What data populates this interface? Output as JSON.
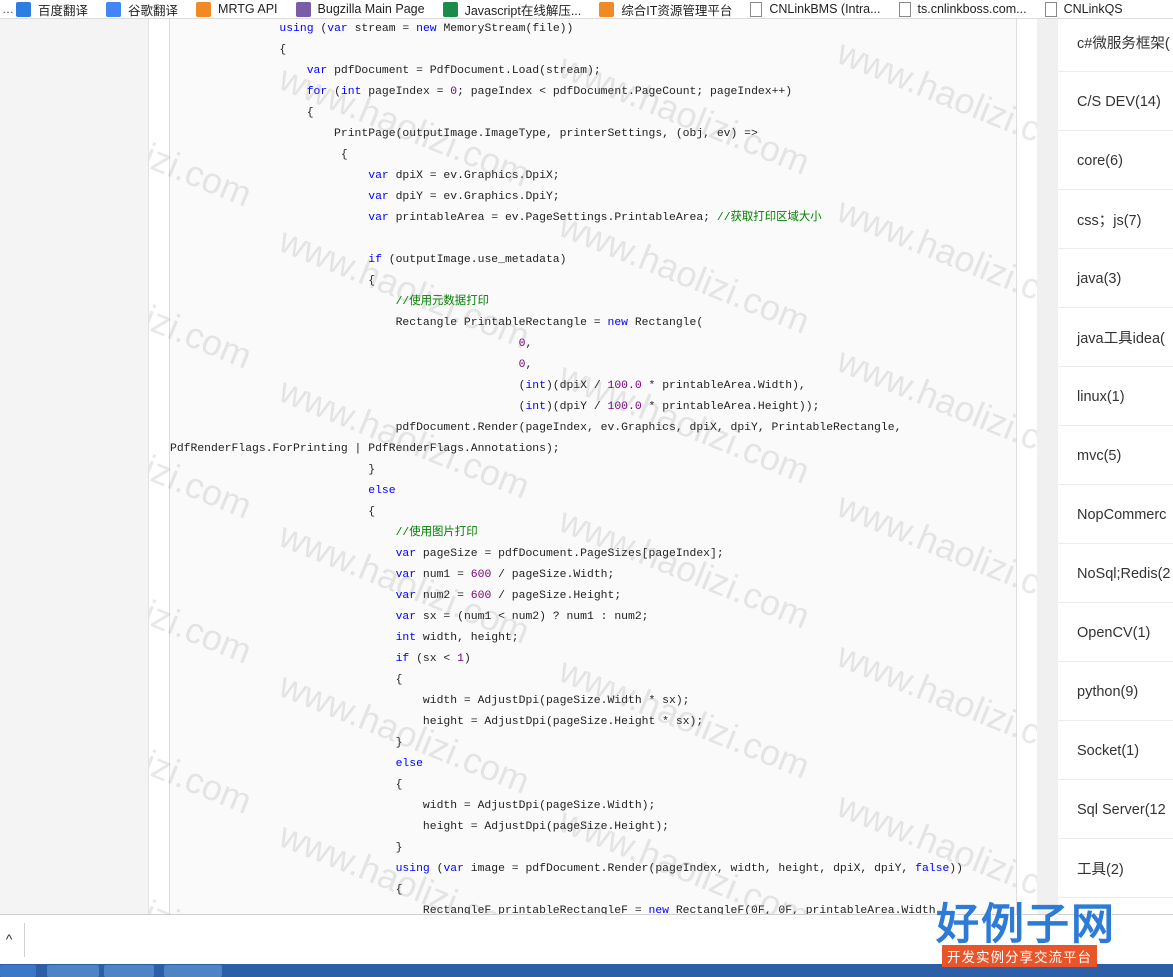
{
  "bookmarks": [
    {
      "label": "百度翻译",
      "icon": "baidu-translate-icon",
      "color": "#2e7de1"
    },
    {
      "label": "谷歌翻译",
      "icon": "google-translate-icon",
      "color": "#4285f4"
    },
    {
      "label": "MRTG API",
      "icon": "mrtg-icon",
      "color": "#f08a24"
    },
    {
      "label": "Bugzilla Main Page",
      "icon": "bugzilla-icon",
      "color": "#7a5ca8"
    },
    {
      "label": "Javascript在线解压...",
      "icon": "javascript-tool-icon",
      "color": "#1d8a4a"
    },
    {
      "label": "综合IT资源管理平台",
      "icon": "it-platform-icon",
      "color": "#f08a24"
    },
    {
      "label": "CNLinkBMS (Intra...",
      "icon": "page-icon",
      "color": "#ffffff"
    },
    {
      "label": "ts.cnlinkboss.com...",
      "icon": "page-icon",
      "color": "#ffffff"
    },
    {
      "label": "CNLinkQS",
      "icon": "page-icon",
      "color": "#ffffff"
    }
  ],
  "code_lines": [
    [
      {
        "t": "pl",
        "v": "                "
      },
      {
        "t": "kw",
        "v": "using"
      },
      {
        "t": "pl",
        "v": " ("
      },
      {
        "t": "kw",
        "v": "var"
      },
      {
        "t": "pl",
        "v": " stream = "
      },
      {
        "t": "kw",
        "v": "new"
      },
      {
        "t": "pl",
        "v": " MemoryStream(file))"
      }
    ],
    [
      {
        "t": "pl",
        "v": "                {"
      }
    ],
    [
      {
        "t": "pl",
        "v": "                    "
      },
      {
        "t": "kw",
        "v": "var"
      },
      {
        "t": "pl",
        "v": " pdfDocument = PdfDocument.Load(stream);"
      }
    ],
    [
      {
        "t": "pl",
        "v": "                    "
      },
      {
        "t": "kw",
        "v": "for"
      },
      {
        "t": "pl",
        "v": " ("
      },
      {
        "t": "kw",
        "v": "int"
      },
      {
        "t": "pl",
        "v": " pageIndex = "
      },
      {
        "t": "num",
        "v": "0"
      },
      {
        "t": "pl",
        "v": "; pageIndex < pdfDocument.PageCount; pageIndex++)"
      }
    ],
    [
      {
        "t": "pl",
        "v": "                    {"
      }
    ],
    [
      {
        "t": "pl",
        "v": "                        PrintPage(outputImage.ImageType, printerSettings, (obj, ev) =>"
      }
    ],
    [
      {
        "t": "pl",
        "v": "                         {"
      }
    ],
    [
      {
        "t": "pl",
        "v": "                             "
      },
      {
        "t": "kw",
        "v": "var"
      },
      {
        "t": "pl",
        "v": " dpiX = ev.Graphics.DpiX;"
      }
    ],
    [
      {
        "t": "pl",
        "v": "                             "
      },
      {
        "t": "kw",
        "v": "var"
      },
      {
        "t": "pl",
        "v": " dpiY = ev.Graphics.DpiY;"
      }
    ],
    [
      {
        "t": "pl",
        "v": "                             "
      },
      {
        "t": "kw",
        "v": "var"
      },
      {
        "t": "pl",
        "v": " printableArea = ev.PageSettings.PrintableArea; "
      },
      {
        "t": "cm",
        "v": "//获取打印区域大小"
      }
    ],
    [
      {
        "t": "pl",
        "v": ""
      }
    ],
    [
      {
        "t": "pl",
        "v": "                             "
      },
      {
        "t": "kw",
        "v": "if"
      },
      {
        "t": "pl",
        "v": " (outputImage.use_metadata)"
      }
    ],
    [
      {
        "t": "pl",
        "v": "                             {"
      }
    ],
    [
      {
        "t": "pl",
        "v": "                                 "
      },
      {
        "t": "cm",
        "v": "//使用元数据打印"
      }
    ],
    [
      {
        "t": "pl",
        "v": "                                 Rectangle PrintableRectangle = "
      },
      {
        "t": "kw",
        "v": "new"
      },
      {
        "t": "pl",
        "v": " Rectangle("
      }
    ],
    [
      {
        "t": "pl",
        "v": "                                                   "
      },
      {
        "t": "num",
        "v": "0"
      },
      {
        "t": "pl",
        "v": ","
      }
    ],
    [
      {
        "t": "pl",
        "v": "                                                   "
      },
      {
        "t": "num",
        "v": "0"
      },
      {
        "t": "pl",
        "v": ","
      }
    ],
    [
      {
        "t": "pl",
        "v": "                                                   ("
      },
      {
        "t": "kw",
        "v": "int"
      },
      {
        "t": "pl",
        "v": ")(dpiX / "
      },
      {
        "t": "num",
        "v": "100.0"
      },
      {
        "t": "pl",
        "v": " * printableArea.Width),"
      }
    ],
    [
      {
        "t": "pl",
        "v": "                                                   ("
      },
      {
        "t": "kw",
        "v": "int"
      },
      {
        "t": "pl",
        "v": ")(dpiY / "
      },
      {
        "t": "num",
        "v": "100.0"
      },
      {
        "t": "pl",
        "v": " * printableArea.Height));"
      }
    ],
    [
      {
        "t": "pl",
        "v": "                                 pdfDocument.Render(pageIndex, ev.Graphics, dpiX, dpiY, PrintableRectangle,"
      }
    ],
    [
      {
        "t": "pl",
        "v": "PdfRenderFlags.ForPrinting | PdfRenderFlags.Annotations);"
      }
    ],
    [
      {
        "t": "pl",
        "v": "                             }"
      }
    ],
    [
      {
        "t": "pl",
        "v": "                             "
      },
      {
        "t": "kw",
        "v": "else"
      }
    ],
    [
      {
        "t": "pl",
        "v": "                             {"
      }
    ],
    [
      {
        "t": "pl",
        "v": "                                 "
      },
      {
        "t": "cm",
        "v": "//使用图片打印"
      }
    ],
    [
      {
        "t": "pl",
        "v": "                                 "
      },
      {
        "t": "kw",
        "v": "var"
      },
      {
        "t": "pl",
        "v": " pageSize = pdfDocument.PageSizes[pageIndex];"
      }
    ],
    [
      {
        "t": "pl",
        "v": "                                 "
      },
      {
        "t": "kw",
        "v": "var"
      },
      {
        "t": "pl",
        "v": " num1 = "
      },
      {
        "t": "num",
        "v": "600"
      },
      {
        "t": "pl",
        "v": " / pageSize.Width;"
      }
    ],
    [
      {
        "t": "pl",
        "v": "                                 "
      },
      {
        "t": "kw",
        "v": "var"
      },
      {
        "t": "pl",
        "v": " num2 = "
      },
      {
        "t": "num",
        "v": "600"
      },
      {
        "t": "pl",
        "v": " / pageSize.Height;"
      }
    ],
    [
      {
        "t": "pl",
        "v": "                                 "
      },
      {
        "t": "kw",
        "v": "var"
      },
      {
        "t": "pl",
        "v": " sx = (num1 < num2) ? num1 : num2;"
      }
    ],
    [
      {
        "t": "pl",
        "v": "                                 "
      },
      {
        "t": "kw",
        "v": "int"
      },
      {
        "t": "pl",
        "v": " width, height;"
      }
    ],
    [
      {
        "t": "pl",
        "v": "                                 "
      },
      {
        "t": "kw",
        "v": "if"
      },
      {
        "t": "pl",
        "v": " (sx < "
      },
      {
        "t": "num",
        "v": "1"
      },
      {
        "t": "pl",
        "v": ")"
      }
    ],
    [
      {
        "t": "pl",
        "v": "                                 {"
      }
    ],
    [
      {
        "t": "pl",
        "v": "                                     width = AdjustDpi(pageSize.Width * sx);"
      }
    ],
    [
      {
        "t": "pl",
        "v": "                                     height = AdjustDpi(pageSize.Height * sx);"
      }
    ],
    [
      {
        "t": "pl",
        "v": "                                 }"
      }
    ],
    [
      {
        "t": "pl",
        "v": "                                 "
      },
      {
        "t": "kw",
        "v": "else"
      }
    ],
    [
      {
        "t": "pl",
        "v": "                                 {"
      }
    ],
    [
      {
        "t": "pl",
        "v": "                                     width = AdjustDpi(pageSize.Width);"
      }
    ],
    [
      {
        "t": "pl",
        "v": "                                     height = AdjustDpi(pageSize.Height);"
      }
    ],
    [
      {
        "t": "pl",
        "v": "                                 }"
      }
    ],
    [
      {
        "t": "pl",
        "v": "                                 "
      },
      {
        "t": "kw",
        "v": "using"
      },
      {
        "t": "pl",
        "v": " ("
      },
      {
        "t": "kw",
        "v": "var"
      },
      {
        "t": "pl",
        "v": " image = pdfDocument.Render(pageIndex, width, height, dpiX, dpiY, "
      },
      {
        "t": "kw",
        "v": "false"
      },
      {
        "t": "pl",
        "v": "))"
      }
    ],
    [
      {
        "t": "pl",
        "v": "                                 {"
      }
    ],
    [
      {
        "t": "pl",
        "v": "                                     RectangleF printableRectangleF = "
      },
      {
        "t": "kw",
        "v": "new"
      },
      {
        "t": "pl",
        "v": " RectangleF(0F, 0F, printableArea.Width,"
      }
    ]
  ],
  "code_colors": {
    "kw": "#0000ff",
    "cm": "#008000",
    "num": "#800080",
    "pl": "#222222"
  },
  "watermark": "www.haolizi.com",
  "sidebar": {
    "categories": [
      "c#微服务框架(",
      "C/S DEV(14)",
      "core(6)",
      "css；js(7)",
      "java(3)",
      "java工具idea(",
      "linux(1)",
      "mvc(5)",
      "NopCommerc",
      "NoSql;Redis(2",
      "OpenCV(1)",
      "python(9)",
      "Socket(1)",
      "Sql Server(12",
      "工具(2)"
    ]
  },
  "bottom_bar": {
    "scroll_up": "^"
  },
  "logo": {
    "main": "好例子网",
    "sub": "开发实例分享交流平台"
  }
}
